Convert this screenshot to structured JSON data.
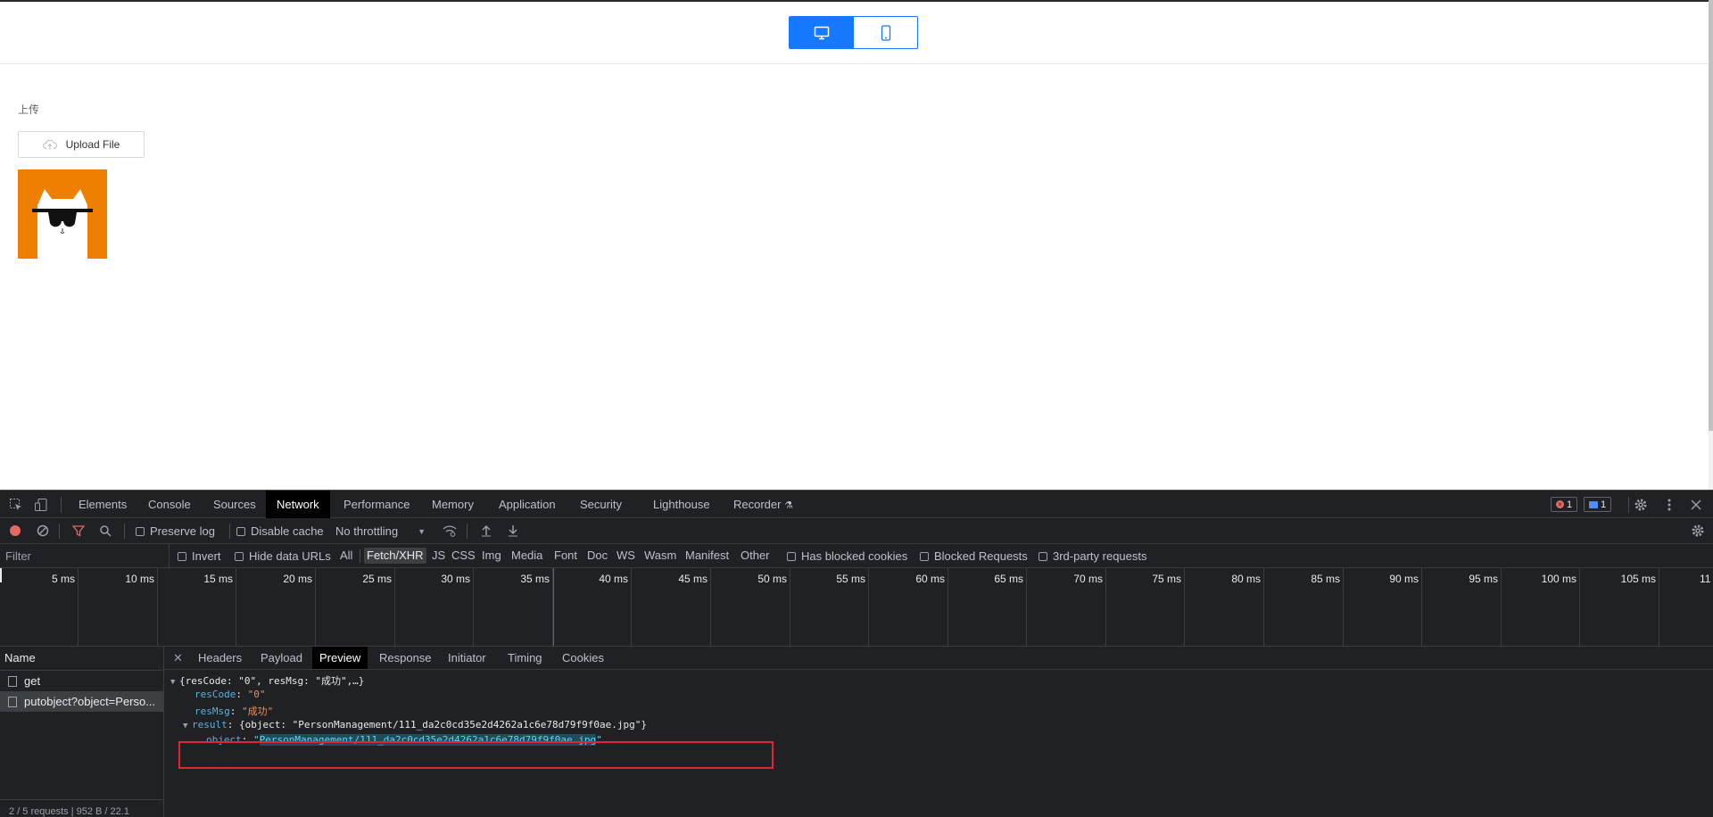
{
  "page": {
    "view_toggle": {
      "desktop_icon": "desktop-icon",
      "mobile_icon": "mobile-icon",
      "active": "desktop"
    },
    "upload_label": "上传",
    "upload_button_label": "Upload File",
    "upload_icon": "cloud-upload-icon",
    "thumbnail": "cat-with-sunglasses-image",
    "colors": {
      "accent": "#1677ff",
      "thumbnail_bg": "#ef7f00"
    }
  },
  "devtools": {
    "tabs": [
      "Elements",
      "Console",
      "Sources",
      "Network",
      "Performance",
      "Memory",
      "Application",
      "Security",
      "Lighthouse",
      "Recorder"
    ],
    "active_tab": "Network",
    "error_count": "1",
    "message_count": "1",
    "toolbar": {
      "preserve_log": "Preserve log",
      "disable_cache": "Disable cache",
      "throttling": "No throttling"
    },
    "filter": {
      "placeholder": "Filter",
      "invert": "Invert",
      "hide_data_urls": "Hide data URLs",
      "types": [
        "All",
        "Fetch/XHR",
        "JS",
        "CSS",
        "Img",
        "Media",
        "Font",
        "Doc",
        "WS",
        "Wasm",
        "Manifest",
        "Other"
      ],
      "active_type": "Fetch/XHR",
      "has_blocked_cookies": "Has blocked cookies",
      "blocked_requests": "Blocked Requests",
      "third_party": "3rd-party requests"
    },
    "timeline_ticks": [
      "5 ms",
      "10 ms",
      "15 ms",
      "20 ms",
      "25 ms",
      "30 ms",
      "35 ms",
      "40 ms",
      "45 ms",
      "50 ms",
      "55 ms",
      "60 ms",
      "65 ms",
      "70 ms",
      "75 ms",
      "80 ms",
      "85 ms",
      "90 ms",
      "95 ms",
      "100 ms",
      "105 ms",
      "11"
    ],
    "request_list": {
      "header": "Name",
      "rows": [
        "get",
        "putobject?object=Perso..."
      ],
      "selected": 1,
      "status": "2 / 5 requests | 952 B / 22.1"
    },
    "detail_tabs": [
      "Headers",
      "Payload",
      "Preview",
      "Response",
      "Initiator",
      "Timing",
      "Cookies"
    ],
    "active_detail_tab": "Preview",
    "preview": {
      "summary": "{resCode: \"0\", resMsg: \"成功\",…}",
      "resCode_key": "resCode",
      "resCode_val": "\"0\"",
      "resMsg_key": "resMsg",
      "resMsg_val": "\"成功\"",
      "result_key": "result",
      "result_summary": "{object: \"PersonManagement/111_da2c0cd35e2d4262a1c6e78d79f9f0ae.jpg\"}",
      "object_key": "object",
      "object_val": "PersonManagement/111_da2c0cd35e2d4262a1c6e78d79f9f0ae.jpg"
    }
  }
}
